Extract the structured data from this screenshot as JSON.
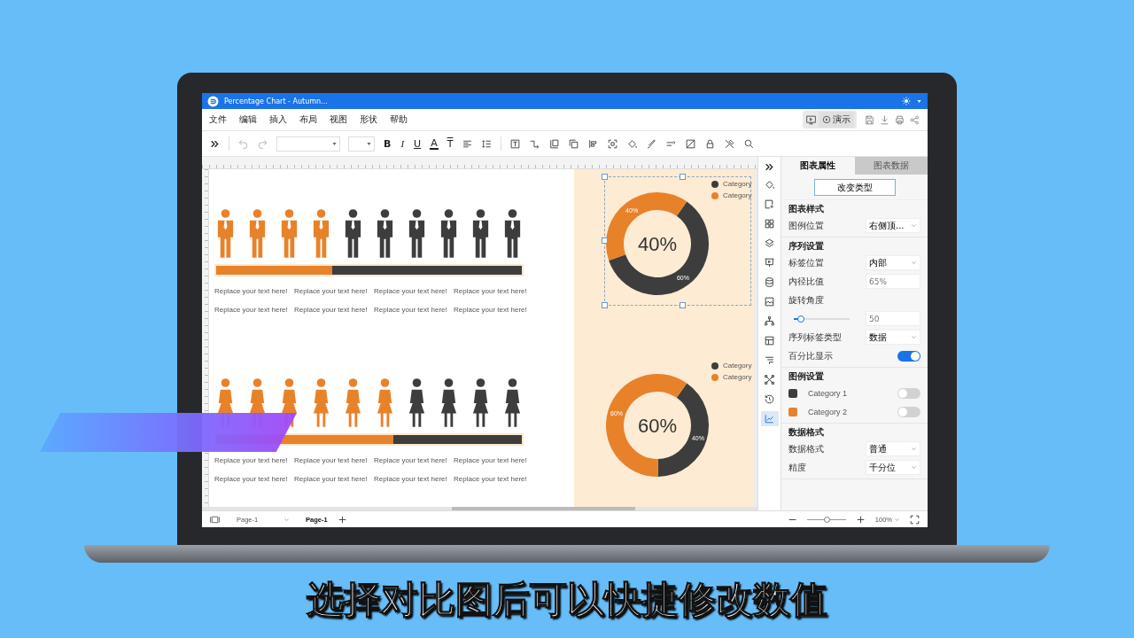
{
  "subtitle": "选择对比图后可以快捷修改数值",
  "app": {
    "title": "Percentage Chart - Autumn...",
    "menu": [
      "文件",
      "编辑",
      "插入",
      "布局",
      "视图",
      "形状",
      "帮助"
    ],
    "present_button": "演示"
  },
  "toolbar": {
    "text_buttons": [
      "B",
      "I",
      "U",
      "A",
      "T"
    ]
  },
  "canvas": {
    "groups": [
      {
        "kind": "male",
        "level": 0.38,
        "figures": [
          {
            "filled": true
          },
          {
            "filled": true
          },
          {
            "filled": true
          },
          {
            "filled": true
          },
          {
            "filled": false
          },
          {
            "filled": false
          },
          {
            "filled": false
          },
          {
            "filled": false
          },
          {
            "filled": false
          },
          {
            "filled": false
          }
        ],
        "texts": [
          [
            "Replace your text here!",
            "Replace your text here!",
            "Replace your text here!",
            "Replace your text here!"
          ],
          [
            "Replace your text here!",
            "Replace your text here!",
            "Replace your text here!",
            "Replace your text here!"
          ]
        ]
      },
      {
        "kind": "female",
        "level": 0.58,
        "figures": [
          {
            "filled": true
          },
          {
            "filled": true
          },
          {
            "filled": true
          },
          {
            "filled": true
          },
          {
            "filled": true
          },
          {
            "filled": true
          },
          {
            "filled": false
          },
          {
            "filled": false
          },
          {
            "filled": false
          },
          {
            "filled": false
          }
        ],
        "texts": [
          [
            "Replace your text here!",
            "Replace your text here!",
            "Replace your text here!",
            "Replace your text here!"
          ],
          [
            "Replace your text here!",
            "Replace your text here!",
            "Replace your text here!",
            "Replace your text here!"
          ]
        ]
      }
    ],
    "charts": [
      {
        "selected": true,
        "center_label": "40%",
        "slices": [
          {
            "color": "#3d3d3d"
          },
          {
            "color": "#e8822a"
          }
        ],
        "chart_data": {
          "type": "donut",
          "categories": [
            "Category",
            "Category"
          ],
          "values": [
            60,
            40
          ],
          "value_labels": [
            "60%",
            "40%"
          ]
        }
      },
      {
        "selected": false,
        "center_label": "60%",
        "slices": [
          {
            "color": "#3d3d3d"
          },
          {
            "color": "#e8822a"
          }
        ],
        "chart_data": {
          "type": "donut",
          "categories": [
            "Category",
            "Category"
          ],
          "values": [
            40,
            60
          ],
          "value_labels": [
            "40%",
            "60%"
          ]
        }
      }
    ]
  },
  "side_tools": [
    {
      "selected": false
    },
    {
      "selected": false
    },
    {
      "selected": false
    },
    {
      "selected": false
    },
    {
      "selected": false
    },
    {
      "selected": false
    },
    {
      "selected": false
    },
    {
      "selected": false
    },
    {
      "selected": false
    },
    {
      "selected": false
    },
    {
      "selected": false
    },
    {
      "selected": false
    },
    {
      "selected": true
    }
  ],
  "panel": {
    "tabs": [
      {
        "label": "图表属性",
        "selected": true
      },
      {
        "label": "图表数据",
        "selected": false
      }
    ],
    "change_type_button": "改变类型",
    "sections": [
      {
        "title": "图表样式",
        "rows": [
          {
            "kind": "select",
            "label": "图例位置",
            "value": "右侧顶..."
          }
        ]
      },
      {
        "title": "序列设置",
        "rows": [
          {
            "kind": "select",
            "label": "标签位置",
            "value": "内部"
          },
          {
            "kind": "input",
            "label": "内径比值",
            "value": "65%"
          },
          {
            "kind": "slider",
            "label": "旋转角度",
            "level": 0.12,
            "value": "50"
          },
          {
            "kind": "select",
            "label": "序列标签类型",
            "value": "数据"
          },
          {
            "kind": "toggle",
            "label": "百分比显示",
            "on": true
          }
        ]
      },
      {
        "title": "图例设置",
        "rows": [
          {
            "kind": "legend",
            "label": "Category 1",
            "color": "#3d3d3d",
            "on": false
          },
          {
            "kind": "legend",
            "label": "Category 2",
            "color": "#e8822a",
            "on": false
          }
        ]
      },
      {
        "title": "数据格式",
        "rows": [
          {
            "kind": "select",
            "label": "数据格式",
            "value": "普通"
          },
          {
            "kind": "select",
            "label": "精度",
            "value": "千分位"
          }
        ]
      }
    ]
  },
  "bottom_bar": {
    "page_select": "Page-1",
    "page_tabs": [
      {
        "label": "Page-1",
        "selected": true
      }
    ],
    "zoom": {
      "level": 0.5,
      "value": "100%"
    }
  }
}
